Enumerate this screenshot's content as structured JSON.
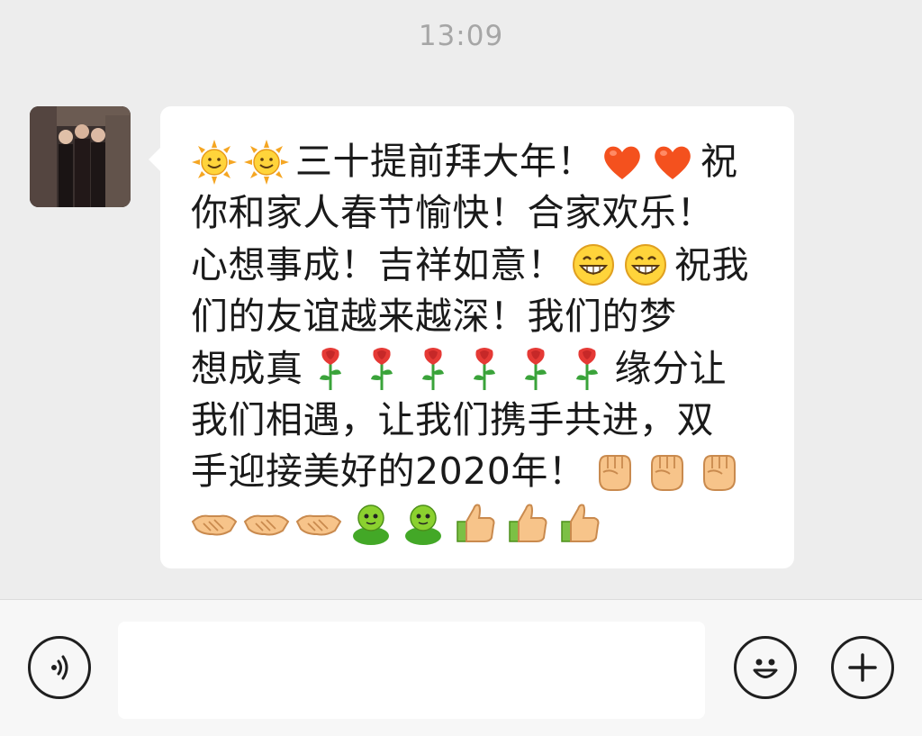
{
  "chat": {
    "timestamp": "13:09",
    "message": {
      "lines": [
        {
          "emoji_before": [
            "sun-icon",
            "sun-icon"
          ],
          "text": "三十提前拜大年！",
          "emoji_after": [
            "heart-icon",
            "heart-icon"
          ],
          "text_after": "祝"
        },
        {
          "text": "你和家人春节愉快！合家欢乐！"
        },
        {
          "text": "心想事成！吉祥如意！",
          "emoji_after": [
            "grin-face-icon",
            "grin-face-icon"
          ],
          "text_after": "祝我"
        },
        {
          "text": "们的友谊越来越深！我们的梦"
        },
        {
          "text": "想成真",
          "emoji_after": [
            "rose-icon",
            "rose-icon",
            "rose-icon",
            "rose-icon",
            "rose-icon",
            "rose-icon"
          ],
          "text_after": "缘分让"
        },
        {
          "text": "我们相遇，让我们携手共进，双"
        },
        {
          "text": "手迎接美好的2020年！",
          "emoji_after": [
            "fist-icon",
            "fist-icon",
            "fist-icon"
          ]
        },
        {
          "emoji_only": [
            "handshake-icon",
            "handshake-icon",
            "handshake-icon",
            "green-person-icon",
            "green-person-icon",
            "thumbs-up-icon",
            "thumbs-up-icon",
            "thumbs-up-icon"
          ]
        }
      ]
    }
  },
  "input_bar": {
    "text_value": "",
    "placeholder": ""
  },
  "colors": {
    "background": "#ededed",
    "bubble": "#ffffff",
    "timestamp": "#a6a6a6",
    "input_bar": "#f7f7f7"
  }
}
